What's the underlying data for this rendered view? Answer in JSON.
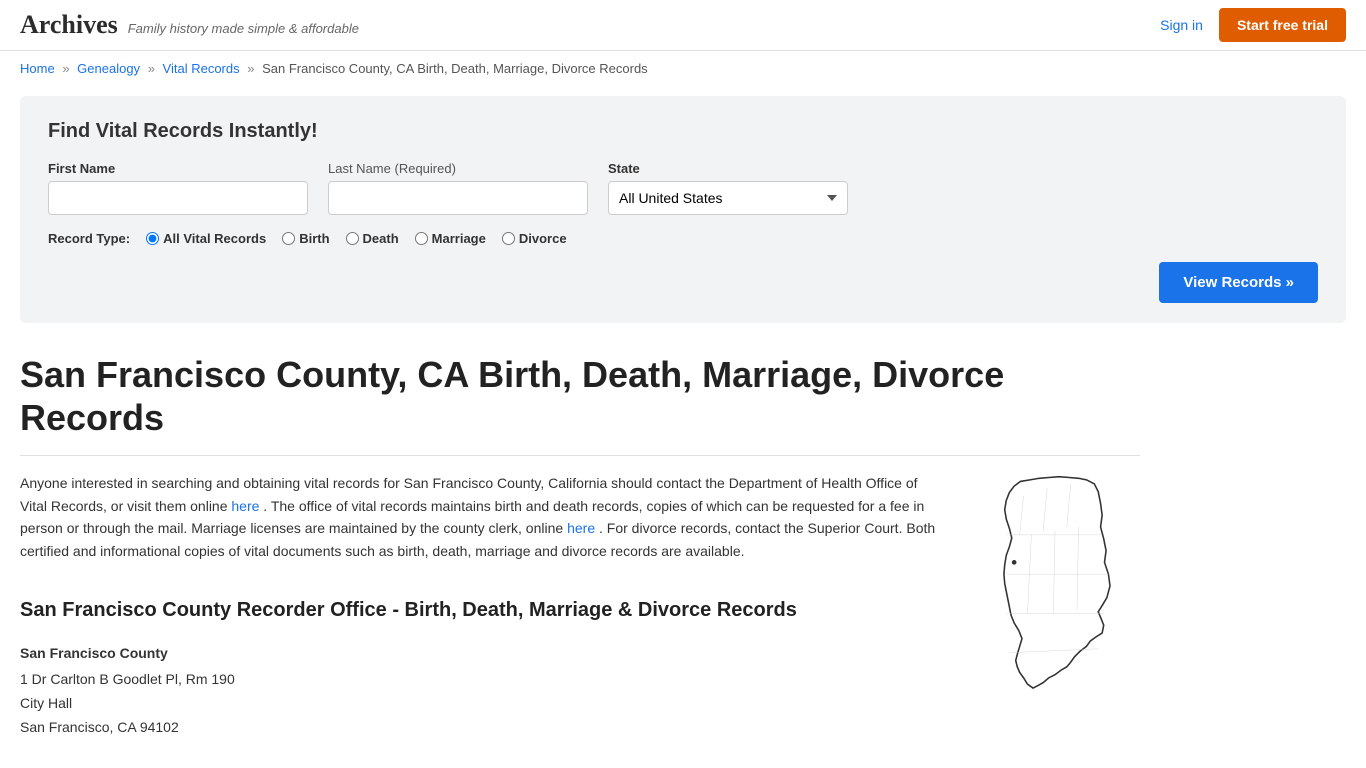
{
  "header": {
    "logo": "Archives",
    "tagline": "Family history made simple & affordable",
    "signin_label": "Sign in",
    "trial_label": "Start free trial"
  },
  "breadcrumb": {
    "home": "Home",
    "genealogy": "Genealogy",
    "vital_records": "Vital Records",
    "current": "San Francisco County, CA Birth, Death, Marriage, Divorce Records"
  },
  "search": {
    "title": "Find Vital Records Instantly!",
    "first_name_label": "First Name",
    "last_name_label": "Last Name",
    "last_name_required": "(Required)",
    "state_label": "State",
    "state_value": "All United States",
    "record_type_label": "Record Type:",
    "record_types": [
      {
        "value": "all",
        "label": "All Vital Records",
        "checked": true
      },
      {
        "value": "birth",
        "label": "Birth",
        "checked": false
      },
      {
        "value": "death",
        "label": "Death",
        "checked": false
      },
      {
        "value": "marriage",
        "label": "Marriage",
        "checked": false
      },
      {
        "value": "divorce",
        "label": "Divorce",
        "checked": false
      }
    ],
    "view_records_btn": "View Records »"
  },
  "page": {
    "title": "San Francisco County, CA Birth, Death, Marriage, Divorce Records",
    "description": "Anyone interested in searching and obtaining vital records for San Francisco County, California should contact the Department of Health Office of Vital Records, or visit them online here . The office of vital records maintains birth and death records, copies of which can be requested for a fee in person or through the mail. Marriage licenses are maintained by the county clerk, online here . For divorce records, contact the Superior Court. Both certified and informational copies of vital documents such as birth, death, marriage and divorce records are available.",
    "here1": "here",
    "here2": "here",
    "recorder_section_title": "San Francisco County Recorder Office - Birth, Death, Marriage & Divorce Records",
    "recorder_name": "San Francisco County",
    "recorder_address_line1": "1 Dr Carlton B Goodlet Pl, Rm 190",
    "recorder_address_line2": "City Hall",
    "recorder_address_line3": "San Francisco, CA 94102"
  }
}
